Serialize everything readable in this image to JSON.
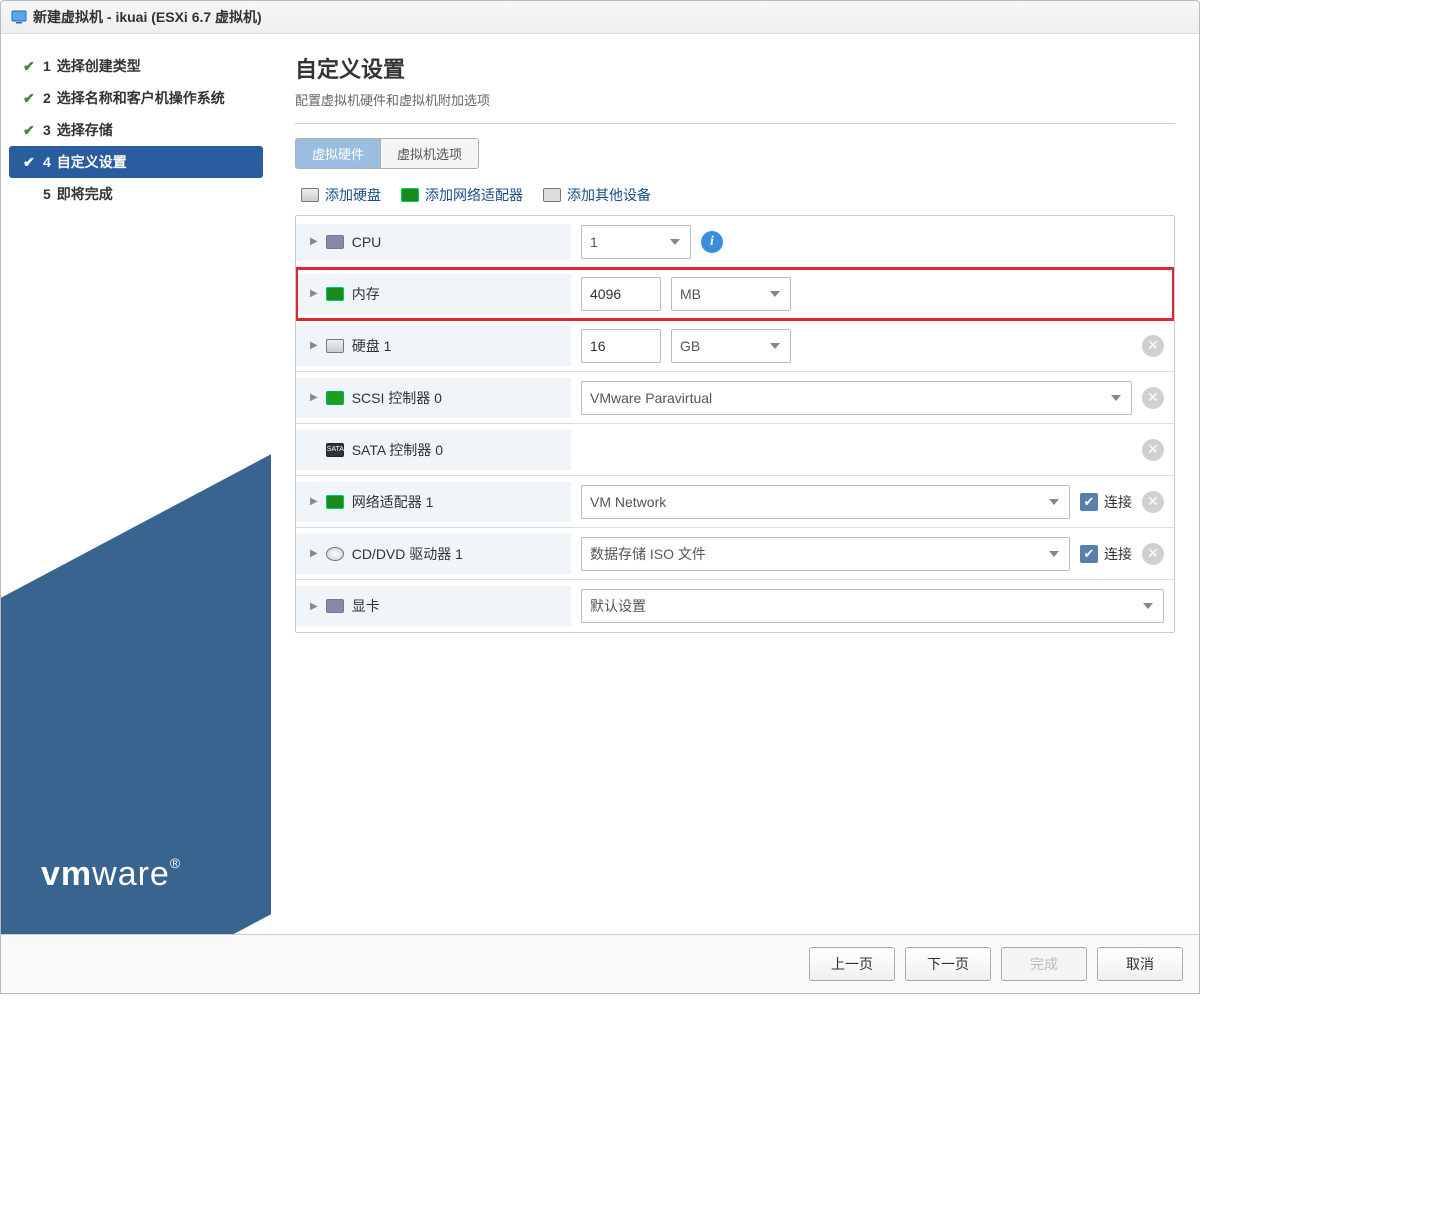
{
  "window": {
    "title": "新建虚拟机 - ikuai (ESXi 6.7 虚拟机)"
  },
  "steps": [
    {
      "num": "1",
      "label": "选择创建类型",
      "done": true
    },
    {
      "num": "2",
      "label": "选择名称和客户机操作系统",
      "done": true
    },
    {
      "num": "3",
      "label": "选择存储",
      "done": true
    },
    {
      "num": "4",
      "label": "自定义设置",
      "active": true
    },
    {
      "num": "5",
      "label": "即将完成"
    }
  ],
  "logo": {
    "thin": "vm",
    "bold": "ware",
    "r": "®"
  },
  "header": {
    "title": "自定义设置",
    "subtitle": "配置虚拟机硬件和虚拟机附加选项"
  },
  "tabs": [
    {
      "label": "虚拟硬件",
      "active": true
    },
    {
      "label": "虚拟机选项"
    }
  ],
  "toolbar": {
    "add_disk": "添加硬盘",
    "add_nic": "添加网络适配器",
    "add_other": "添加其他设备"
  },
  "rows": {
    "cpu": {
      "label": "CPU",
      "value": "1"
    },
    "mem": {
      "label": "内存",
      "value": "4096",
      "unit": "MB"
    },
    "disk": {
      "label": "硬盘 1",
      "value": "16",
      "unit": "GB"
    },
    "scsi": {
      "label": "SCSI 控制器 0",
      "value": "VMware Paravirtual"
    },
    "sata": {
      "label": "SATA 控制器 0"
    },
    "nic": {
      "label": "网络适配器 1",
      "value": "VM Network",
      "connect": "连接"
    },
    "cd": {
      "label": "CD/DVD 驱动器 1",
      "value": "数据存储 ISO 文件",
      "connect": "连接"
    },
    "video": {
      "label": "显卡",
      "value": "默认设置"
    }
  },
  "footer": {
    "prev": "上一页",
    "next": "下一页",
    "finish": "完成",
    "cancel": "取消"
  }
}
